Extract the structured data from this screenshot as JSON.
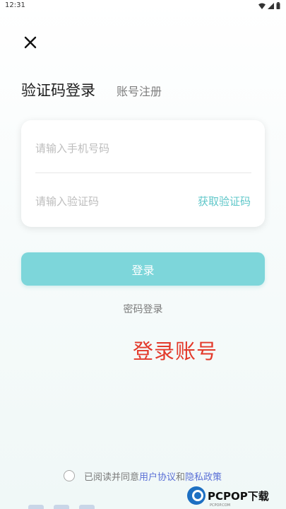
{
  "status_bar": {
    "time": "12:31"
  },
  "header": {
    "close_icon": "close-icon",
    "tab_login": "验证码登录",
    "tab_register": "账号注册"
  },
  "form": {
    "phone_placeholder": "请输入手机号码",
    "code_placeholder": "请输入验证码",
    "get_code_label": "获取验证码"
  },
  "actions": {
    "login_label": "登录",
    "password_login_label": "密码登录"
  },
  "caption": "登录账号",
  "agreement": {
    "prefix": "已阅读并同意",
    "user_agreement": "用户协议",
    "and": "和",
    "privacy_policy": "隐私政策"
  },
  "watermark": {
    "text": "PCPOP下载",
    "sub": "PCPOP.COM"
  },
  "colors": {
    "accent": "#7dd6da",
    "link": "#5a6fd6",
    "get_code": "#5fc7c9",
    "caption": "#e3392a"
  }
}
